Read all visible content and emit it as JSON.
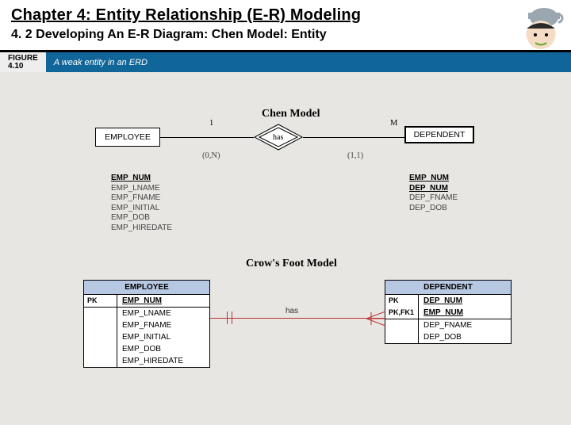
{
  "header": {
    "title": "Chapter 4: Entity Relationship (E-R) Modeling",
    "subtitle": "4. 2 Developing An E-R Diagram: Chen Model: Entity"
  },
  "figure": {
    "num_line1": "FIGURE",
    "num_line2": "4.10",
    "caption": "A weak entity in an ERD"
  },
  "chen": {
    "title": "Chen Model",
    "entity1": "EMPLOYEE",
    "entity2": "DEPENDENT",
    "rel": "has",
    "card1": "1",
    "card2": "M",
    "part1": "(0,N)",
    "part2": "(1,1)",
    "attrs1": [
      "EMP_NUM",
      "EMP_LNAME",
      "EMP_FNAME",
      "EMP_INITIAL",
      "EMP_DOB",
      "EMP_HIREDATE"
    ],
    "attrs2": [
      "EMP_NUM",
      "DEP_NUM",
      "DEP_FNAME",
      "DEP_DOB"
    ],
    "pk1_idx": [
      0
    ],
    "pk2_idx": [
      0,
      1
    ]
  },
  "crows": {
    "title": "Crow's Foot Model",
    "entity1": "EMPLOYEE",
    "entity2": "DEPENDENT",
    "rel": "has",
    "t1_key_rows": [
      {
        "k": "PK",
        "a": "EMP_NUM",
        "u": true
      }
    ],
    "t1_rows": [
      {
        "k": "",
        "a": "EMP_LNAME"
      },
      {
        "k": "",
        "a": "EMP_FNAME"
      },
      {
        "k": "",
        "a": "EMP_INITIAL"
      },
      {
        "k": "",
        "a": "EMP_DOB"
      },
      {
        "k": "",
        "a": "EMP_HIREDATE"
      }
    ],
    "t2_key_rows": [
      {
        "k": "PK",
        "a": "DEP_NUM",
        "u": true
      },
      {
        "k": "PK,FK1",
        "a": "EMP_NUM",
        "u": true
      }
    ],
    "t2_rows": [
      {
        "k": "",
        "a": "DEP_FNAME"
      },
      {
        "k": "",
        "a": "DEP_DOB"
      }
    ]
  }
}
